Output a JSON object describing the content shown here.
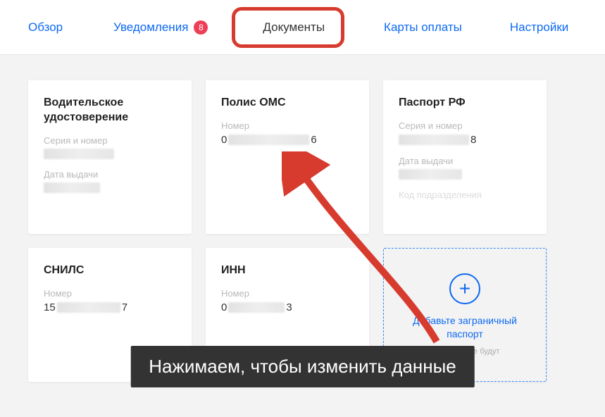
{
  "tabs": {
    "overview": "Обзор",
    "notifications": "Уведомления",
    "notifications_badge": "8",
    "documents": "Документы",
    "payment_cards": "Карты оплаты",
    "settings": "Настройки"
  },
  "cards": {
    "drivers_license": {
      "title": "Водительское удостоверение",
      "series_label": "Серия и номер",
      "issue_date_label": "Дата выдачи"
    },
    "oms": {
      "title": "Полис ОМС",
      "number_label": "Номер",
      "number_prefix": "0",
      "number_suffix": "6"
    },
    "passport_rf": {
      "title": "Паспорт РФ",
      "series_label": "Серия и номер",
      "series_suffix": "8",
      "issue_date_label": "Дата выдачи",
      "division_label": "Код подразделения"
    },
    "snils": {
      "title": "СНИЛС",
      "number_label": "Номер",
      "number_prefix": "15",
      "number_suffix": "7"
    },
    "inn": {
      "title": "ИНН",
      "number_label": "Номер",
      "number_prefix": "0",
      "number_suffix": "3"
    },
    "add_foreign_passport": {
      "title": "Добавьте заграничный паспорт",
      "subtitle": "и эти данные будут"
    }
  },
  "annotation": {
    "caption": "Нажимаем, чтобы изменить данные"
  }
}
